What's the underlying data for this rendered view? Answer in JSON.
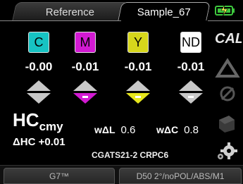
{
  "tabs": {
    "reference": "Reference",
    "sample": "Sample_67"
  },
  "channels": [
    {
      "letter": "C",
      "value": "-0.00",
      "color": "#17c3c3"
    },
    {
      "letter": "M",
      "value": "-0.01",
      "color": "#d21ad2"
    },
    {
      "letter": "Y",
      "value": "-0.01",
      "color": "#d6d61c"
    },
    {
      "letter": "ND",
      "value": "-0.01",
      "color": "#ffffff"
    }
  ],
  "hc": {
    "main": "HC",
    "sub": "cmy",
    "delta": "ΔHC +0.01"
  },
  "weights": {
    "wdl_label": "wΔL",
    "wdl_value": "0.6",
    "wdc_label": "wΔC",
    "wdc_value": "0.8"
  },
  "reference_label": "CGATS21-2 CRPC6",
  "bottom": {
    "left_button": "G7™",
    "right_button": "D50 2°/noPOL/ABS/M1"
  },
  "right_tools": [
    "calibrate-icon",
    "measure-delta-icon",
    "no-compare-icon",
    "sample-icon",
    "settings-gear-icon"
  ],
  "colors": {
    "accent_green": "#3ec83e",
    "bg": "#000000"
  }
}
